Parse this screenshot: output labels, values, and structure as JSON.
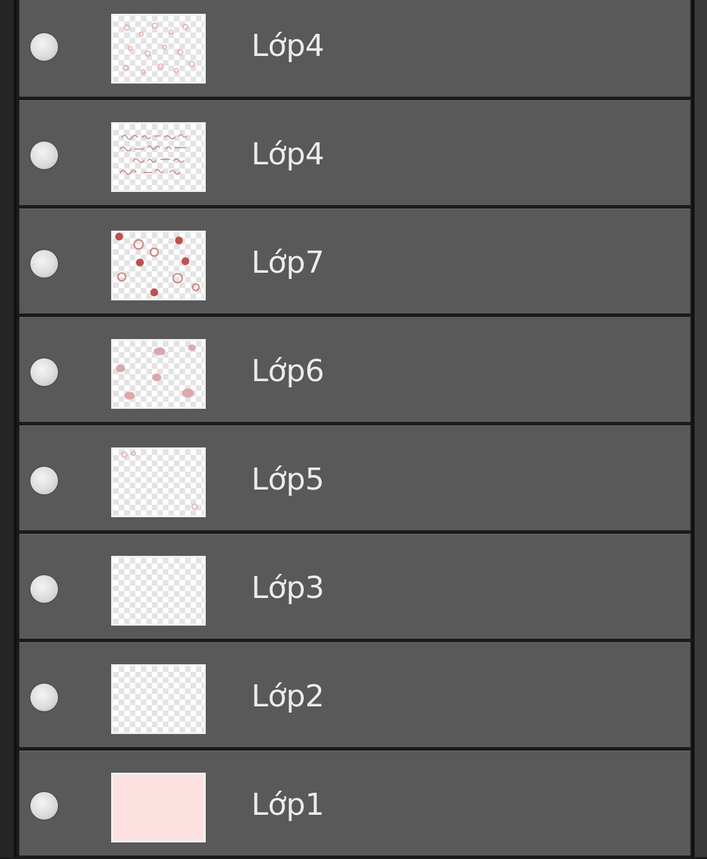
{
  "layers": [
    {
      "name": "Lớp4",
      "thumbnail": "pattern-faint-dots"
    },
    {
      "name": "Lớp4",
      "thumbnail": "pattern-handwriting"
    },
    {
      "name": "Lớp7",
      "thumbnail": "pattern-red-circles"
    },
    {
      "name": "Lớp6",
      "thumbnail": "pattern-pink-blobs"
    },
    {
      "name": "Lớp5",
      "thumbnail": "transparent-corner-marks"
    },
    {
      "name": "Lớp3",
      "thumbnail": "transparent"
    },
    {
      "name": "Lớp2",
      "thumbnail": "transparent"
    },
    {
      "name": "Lớp1",
      "thumbnail": "solid-fill",
      "fill": "#fde0e0"
    }
  ],
  "icons": {
    "visibility": "visibility-eye-icon"
  },
  "colors": {
    "panel_bg": "#595959",
    "separator": "#111111",
    "text": "#ececec",
    "accent_red": "#c0504d"
  }
}
